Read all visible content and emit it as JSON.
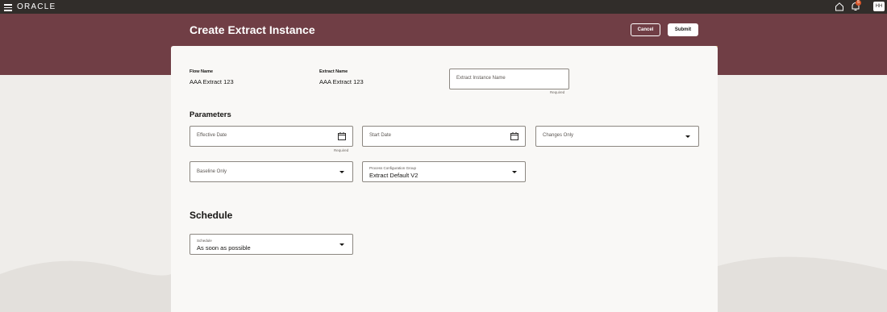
{
  "topbar": {
    "logo": "ORACLE",
    "badge_count": "5",
    "avatar_initials": "HH"
  },
  "header": {
    "title": "Create Extract Instance",
    "cancel_label": "Cancel",
    "submit_label": "Submit"
  },
  "summary": {
    "flow_name_label": "Flow Name",
    "flow_name_value": "AAA Extract 123",
    "extract_name_label": "Extract Name",
    "extract_name_value": "AAA Extract 123",
    "instance_name_placeholder": "Extract Instance Name",
    "instance_name_required": "Required"
  },
  "parameters": {
    "title": "Parameters",
    "effective_date_placeholder": "Effective Date",
    "effective_date_required": "Required",
    "start_date_placeholder": "Start Date",
    "changes_only_placeholder": "Changes Only",
    "baseline_only_placeholder": "Baseline Only",
    "process_config_label": "Process Configuration Group",
    "process_config_value": "Extract Default V2"
  },
  "schedule": {
    "title": "Schedule",
    "schedule_label": "Schedule",
    "schedule_value": "As soon as possible"
  },
  "colors": {
    "topbar": "#312d2a",
    "banner": "#703e45",
    "background": "#efedea",
    "card": "#f9f8f6",
    "badge": "#d9572b"
  }
}
